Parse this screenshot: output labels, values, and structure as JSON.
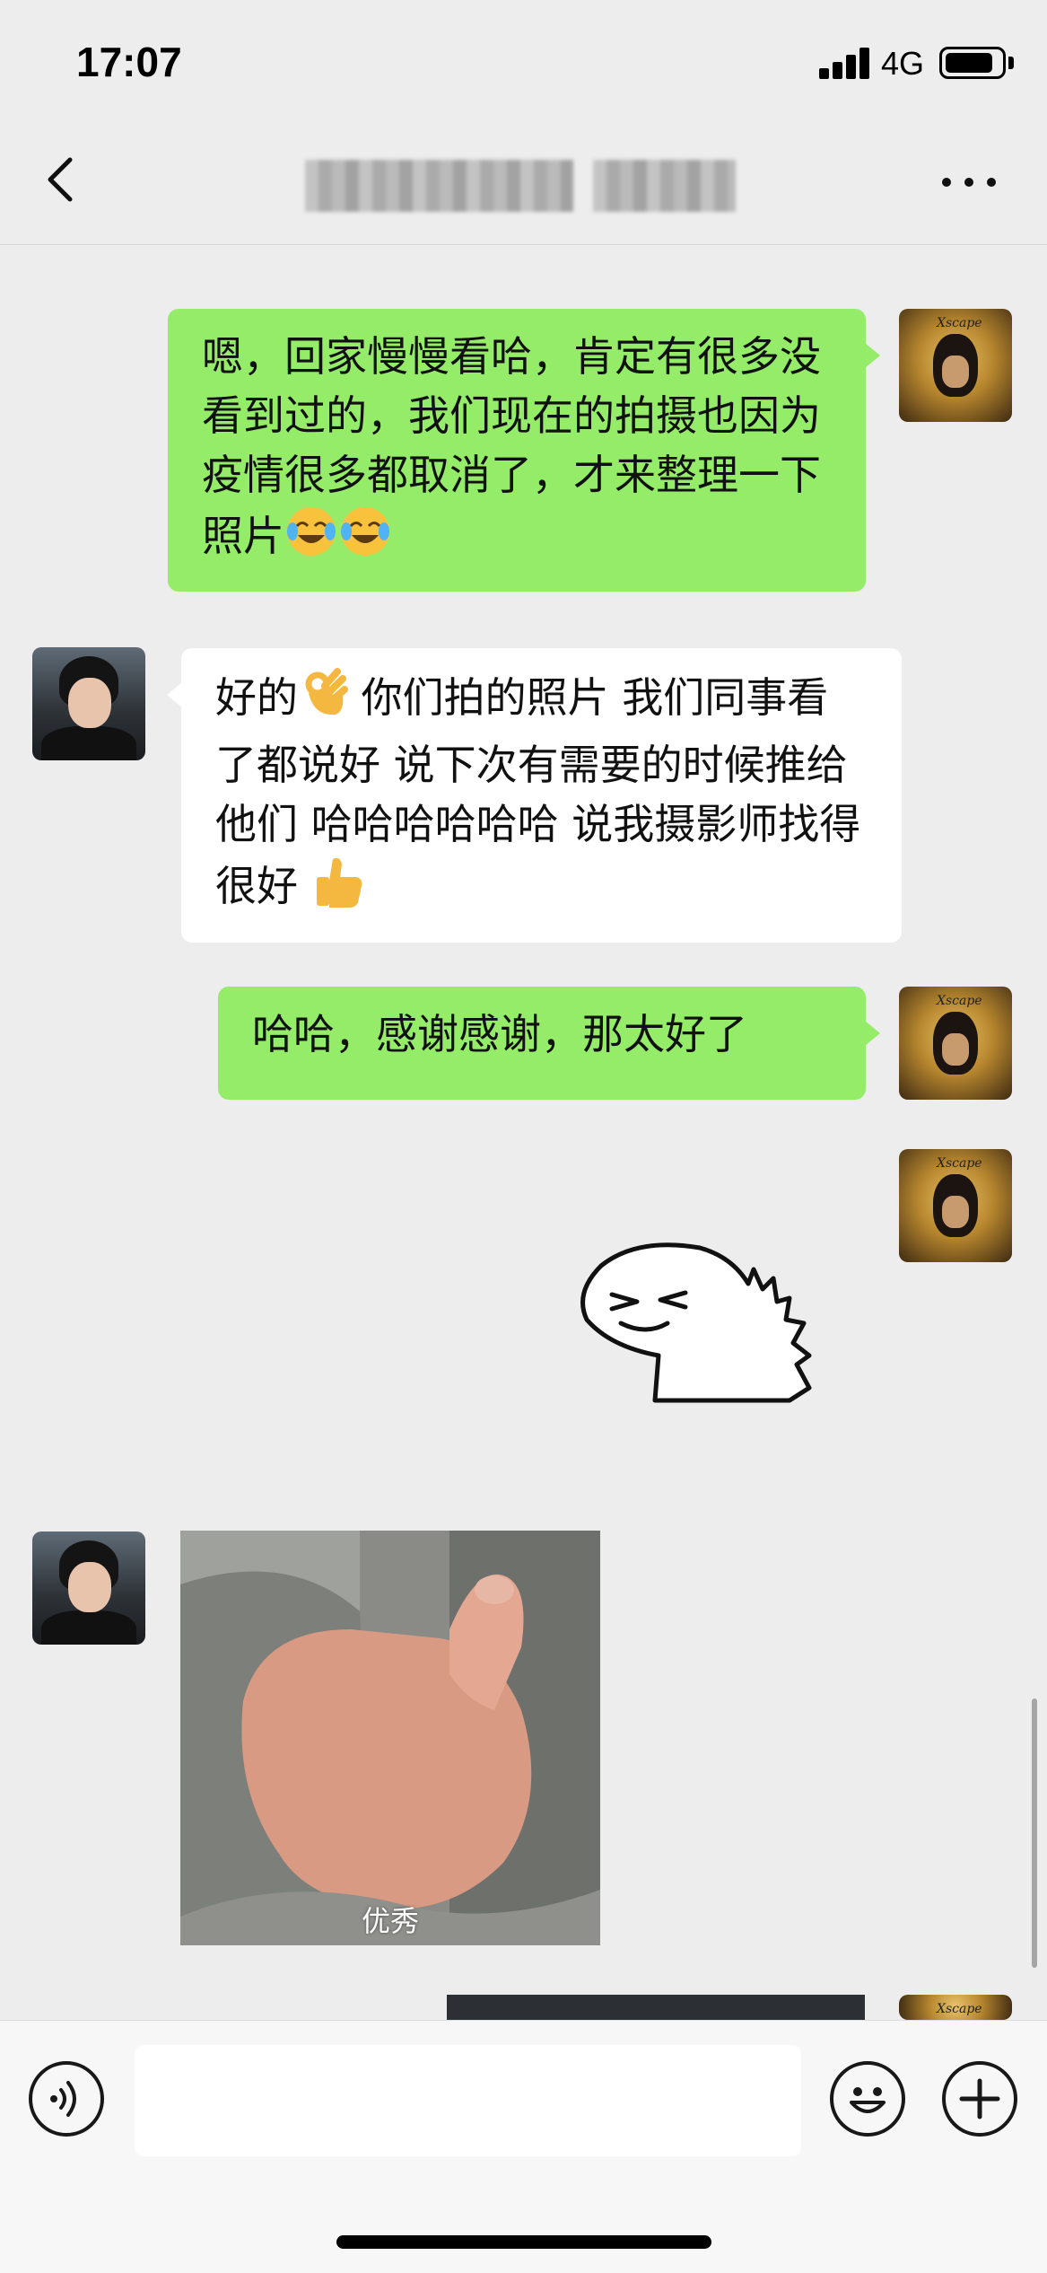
{
  "status_bar": {
    "time": "17:07",
    "network": "4G"
  },
  "nav": {
    "title_obscured": true
  },
  "messages": [
    {
      "from": "me",
      "text": "嗯，回家慢慢看哈，肯定有很多没看到过的，我们现在的拍摄也因为疫情很多都取消了，才来整理一下照片",
      "emojis": [
        "laugh-cry-emoji",
        "laugh-cry-emoji"
      ]
    },
    {
      "from": "friend",
      "text_a": "好的",
      "emoji_a": "ok-hand-emoji",
      "text_b": " 你们拍的照片 我们同事看了都说好 说下次有需要的时候推给他们 哈哈哈哈哈哈 说我摄影师找得很好 ",
      "emoji_b": "thumbs-up-emoji"
    },
    {
      "from": "me",
      "text": "哈哈，感谢感谢，那太好了"
    },
    {
      "from": "me",
      "type": "sticker",
      "sticker": "dinosaur-laughing-sticker"
    },
    {
      "from": "friend",
      "type": "image",
      "caption": "优秀"
    }
  ],
  "input_bar": {
    "placeholder": "",
    "voice_icon": "voice-icon",
    "emoji_icon": "emoji-icon",
    "plus_icon": "plus-icon"
  },
  "colors": {
    "outgoing_bubble": "#95ec69",
    "incoming_bubble": "#ffffff",
    "background": "#ededed"
  }
}
